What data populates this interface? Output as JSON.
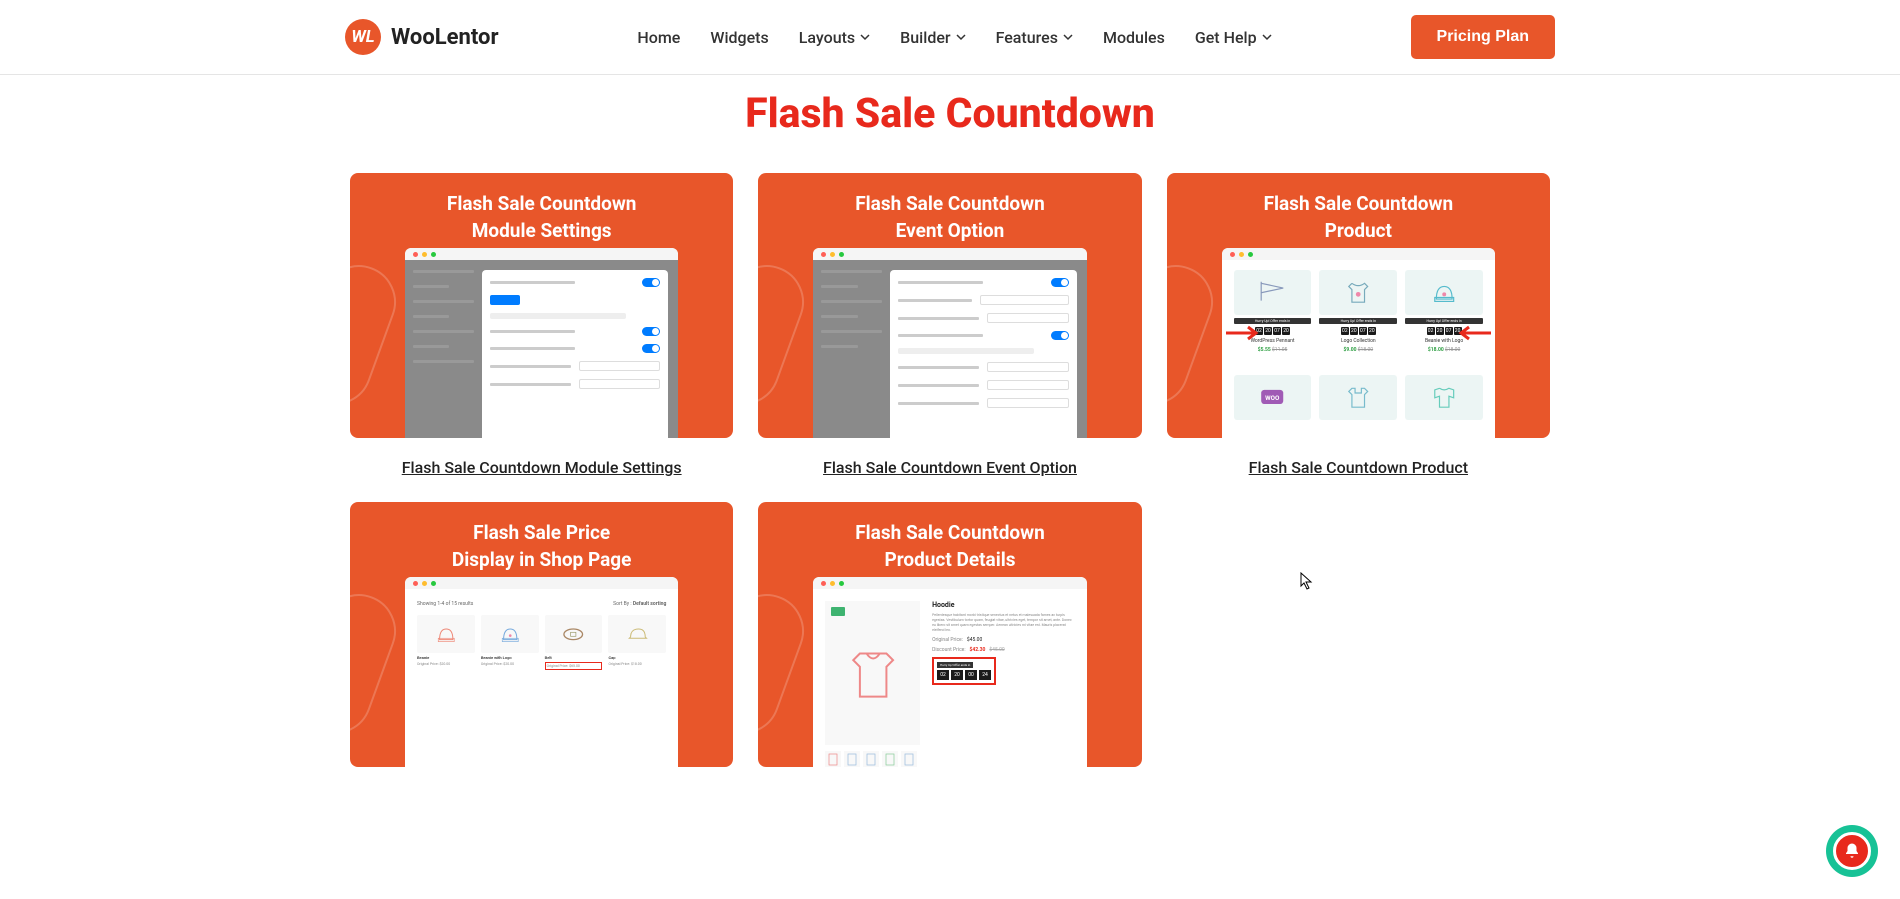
{
  "header": {
    "logo_text": "WooLentor",
    "nav": [
      "Home",
      "Widgets",
      "Layouts",
      "Builder",
      "Features",
      "Modules",
      "Get Help"
    ],
    "nav_has_chevron": [
      false,
      false,
      true,
      true,
      true,
      false,
      true
    ],
    "cta": "Pricing Plan"
  },
  "page": {
    "title": "Flash Sale Countdown"
  },
  "cards": [
    {
      "title": "Flash Sale Countdown\nModule Settings",
      "caption": "Flash Sale Countdown Module Settings",
      "mock": "settings1"
    },
    {
      "title": "Flash Sale Countdown\nEvent Option",
      "caption": "Flash Sale Countdown Event Option",
      "mock": "settings2"
    },
    {
      "title": "Flash Sale Countdown\nProduct",
      "caption": "Flash Sale Countdown Product",
      "mock": "products"
    },
    {
      "title": "Flash Sale Price\nDisplay in Shop Page",
      "caption": "Flash Sale Price Display in Shop Page",
      "mock": "shop"
    },
    {
      "title": "Flash Sale Countdown\nProduct Details",
      "caption": "Flash Sale Countdown Product Details",
      "mock": "detail"
    }
  ],
  "products_mock": {
    "countdown_label": "Hurry Up! Offer ends in",
    "cd": [
      "02",
      "20",
      "07",
      "20"
    ],
    "items": [
      {
        "name": "WordPress Pennant",
        "sale": "$5.55",
        "old": "$11.05",
        "icon": "pennant"
      },
      {
        "name": "Logo Collection",
        "sale": "$9.00",
        "old": "$18.00",
        "icon": "shirt"
      },
      {
        "name": "Beanie with Logo",
        "sale": "$18.00",
        "old": "$18.00",
        "icon": "beanie"
      },
      {
        "name": "",
        "sale": "",
        "old": "",
        "icon": "woo"
      },
      {
        "name": "",
        "sale": "",
        "old": "",
        "icon": "polo"
      },
      {
        "name": "",
        "sale": "",
        "old": "",
        "icon": "sleeve"
      }
    ]
  },
  "shop_mock": {
    "results": "Showing 1-4 of 15 results",
    "sort_label": "Sort By :",
    "sort_value": "Default sorting",
    "items": [
      {
        "name": "Beanie",
        "price": "Original Price: $20.00",
        "icon": "beanie-orange"
      },
      {
        "name": "Beanie with Logo",
        "price": "Original Price: $20.00",
        "icon": "beanie-blue"
      },
      {
        "name": "Belt",
        "price": "Original Price: $65.00",
        "hl": true,
        "icon": "belt"
      },
      {
        "name": "Cap",
        "price": "Original Price: $18.00",
        "icon": "cap"
      }
    ]
  },
  "detail_mock": {
    "title": "Hoodie",
    "desc": "Pellentesque habitant morbi tristique senectus et netus et malesuada fames ac turpis egestas. Vestibulum tortor quam, feugiat vitae, ultricies eget, tempor sit amet, ante. Donec eu libero sit amet quam egestas semper. Aenean ultricies mi vitae est. Mauris placerat eleifend leo.",
    "orig_label": "Original Price:",
    "orig": "$45.00",
    "discount_label": "Discount Price:",
    "discount_new": "$42.30",
    "discount_old": "$45.00",
    "cd_label": "Hurry Up! Offer ends in",
    "cd": [
      "02",
      "20",
      "00",
      "24"
    ]
  }
}
